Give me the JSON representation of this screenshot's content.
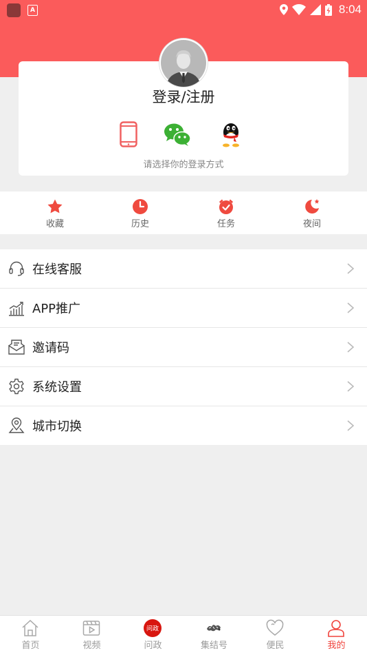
{
  "status_bar": {
    "time": "8:04",
    "icons": [
      "app-icon",
      "a-icon",
      "location-icon",
      "wifi-icon",
      "signal-icon",
      "battery-icon"
    ]
  },
  "login": {
    "title": "登录/注册",
    "hint": "请选择你的登录方式",
    "methods": [
      {
        "icon": "phone-icon"
      },
      {
        "icon": "wechat-icon"
      },
      {
        "icon": "qq-icon"
      }
    ]
  },
  "quick_actions": [
    {
      "label": "收藏",
      "icon": "star-icon"
    },
    {
      "label": "历史",
      "icon": "clock-icon"
    },
    {
      "label": "任务",
      "icon": "alarm-icon"
    },
    {
      "label": "夜间",
      "icon": "moon-icon"
    }
  ],
  "menu": [
    {
      "label": "在线客服",
      "icon": "headset-icon"
    },
    {
      "label": "APP推广",
      "icon": "chart-icon"
    },
    {
      "label": "邀请码",
      "icon": "envelope-icon"
    },
    {
      "label": "系统设置",
      "icon": "gear-icon"
    },
    {
      "label": "城市切换",
      "icon": "location-pin-icon"
    }
  ],
  "bottom_nav": [
    {
      "label": "首页",
      "icon": "home-icon"
    },
    {
      "label": "视频",
      "icon": "video-icon"
    },
    {
      "label": "问政",
      "icon": "wenzheng-logo-icon",
      "logo_text": "问政"
    },
    {
      "label": "集结号",
      "icon": "jijiehao-logo-icon"
    },
    {
      "label": "便民",
      "icon": "heart-icon"
    },
    {
      "label": "我的",
      "icon": "user-icon"
    }
  ],
  "colors": {
    "accent": "#f0443d",
    "header": "#fb5b5b",
    "background": "#efefef"
  }
}
